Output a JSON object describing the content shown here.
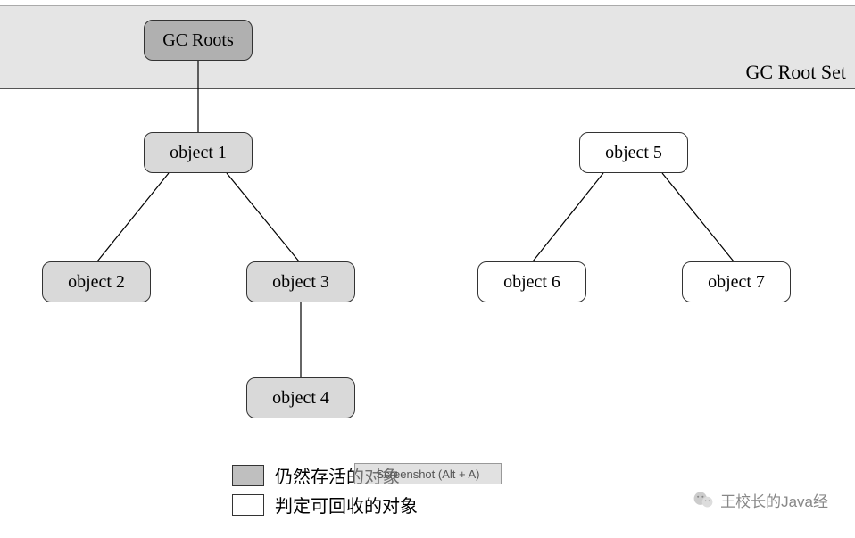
{
  "rootSet": {
    "label": "GC Root Set"
  },
  "nodes": {
    "gcRoots": "GC Roots",
    "obj1": "object 1",
    "obj2": "object 2",
    "obj3": "object 3",
    "obj4": "object 4",
    "obj5": "object 5",
    "obj6": "object 6",
    "obj7": "object 7"
  },
  "legend": {
    "alive": "仍然存活的对象",
    "recycle": "判定可回收的对象"
  },
  "overlay": {
    "text": "Screenshot (Alt + A)"
  },
  "watermark": {
    "text": "王校长的Java经"
  }
}
